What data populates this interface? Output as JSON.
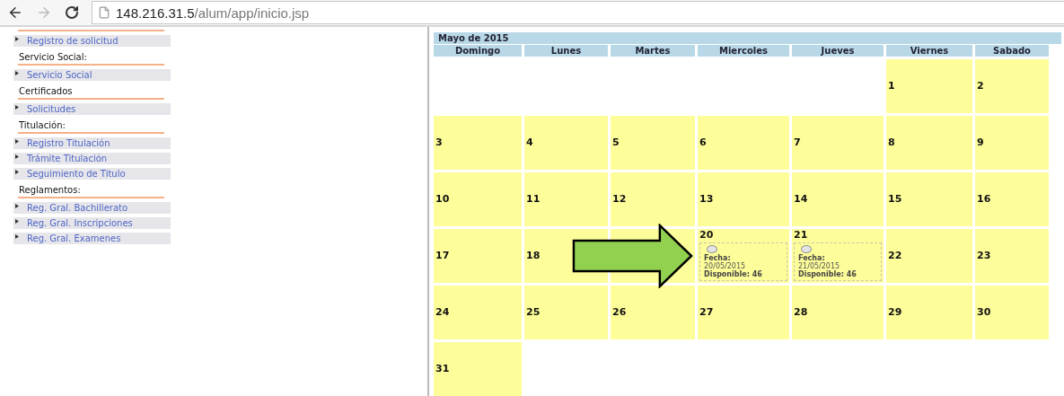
{
  "browser": {
    "url_host": "148.216.31.5",
    "url_path": "/alum/app/inicio.jsp"
  },
  "sidebar": {
    "sections": [
      {
        "items": [
          "Registro de solicitud"
        ]
      },
      {
        "heading": "Servicio Social:",
        "items": [
          "Servicio Social"
        ]
      },
      {
        "heading": "Certificados",
        "items": [
          "Solicitudes"
        ]
      },
      {
        "heading": "Titulación:",
        "items": [
          "Registro Titulación",
          "Trámite Titulación",
          "Seguimiento de Titulo"
        ]
      },
      {
        "heading": "Reglamentos:",
        "items": [
          "Reg. Gral. Bachillerato",
          "Reg. Gral. Inscripciones",
          "Reg. Gral. Examenes"
        ]
      }
    ]
  },
  "calendar": {
    "title": "Mayo de 2015",
    "weekdays": [
      "Domingo",
      "Lunes",
      "Martes",
      "Miercoles",
      "Jueves",
      "Viernes",
      "Sabado"
    ],
    "weeks": [
      [
        {
          "kind": "empty"
        },
        {
          "kind": "empty"
        },
        {
          "kind": "empty"
        },
        {
          "kind": "empty"
        },
        {
          "kind": "empty"
        },
        {
          "kind": "day",
          "day": "1"
        },
        {
          "kind": "day",
          "day": "2"
        }
      ],
      [
        {
          "kind": "day",
          "day": "3"
        },
        {
          "kind": "day",
          "day": "4"
        },
        {
          "kind": "day",
          "day": "5"
        },
        {
          "kind": "day",
          "day": "6"
        },
        {
          "kind": "day",
          "day": "7"
        },
        {
          "kind": "day",
          "day": "8"
        },
        {
          "kind": "day",
          "day": "9"
        }
      ],
      [
        {
          "kind": "day",
          "day": "10"
        },
        {
          "kind": "day",
          "day": "11"
        },
        {
          "kind": "day",
          "day": "12"
        },
        {
          "kind": "day",
          "day": "13"
        },
        {
          "kind": "day",
          "day": "14"
        },
        {
          "kind": "day",
          "day": "15"
        },
        {
          "kind": "day",
          "day": "16"
        }
      ],
      [
        {
          "kind": "day",
          "day": "17"
        },
        {
          "kind": "day",
          "day": "18"
        },
        {
          "kind": "blank"
        },
        {
          "kind": "slot",
          "day": "20",
          "slot": {
            "label": "Fecha:",
            "date": "20/05/2015",
            "availability": "Disponible: 46",
            "selected": false
          }
        },
        {
          "kind": "slot",
          "day": "21",
          "slot": {
            "label": "Fecha:",
            "date": "21/05/2015",
            "availability": "Disponible: 46",
            "selected": false
          }
        },
        {
          "kind": "day",
          "day": "22"
        },
        {
          "kind": "day",
          "day": "23"
        }
      ],
      [
        {
          "kind": "day",
          "day": "24"
        },
        {
          "kind": "day",
          "day": "25"
        },
        {
          "kind": "day",
          "day": "26"
        },
        {
          "kind": "day",
          "day": "27"
        },
        {
          "kind": "day",
          "day": "28"
        },
        {
          "kind": "day",
          "day": "29"
        },
        {
          "kind": "day",
          "day": "30"
        }
      ],
      [
        {
          "kind": "day",
          "day": "31"
        },
        {
          "kind": "empty"
        },
        {
          "kind": "empty"
        },
        {
          "kind": "empty"
        },
        {
          "kind": "empty"
        },
        {
          "kind": "empty"
        },
        {
          "kind": "empty"
        }
      ]
    ]
  }
}
